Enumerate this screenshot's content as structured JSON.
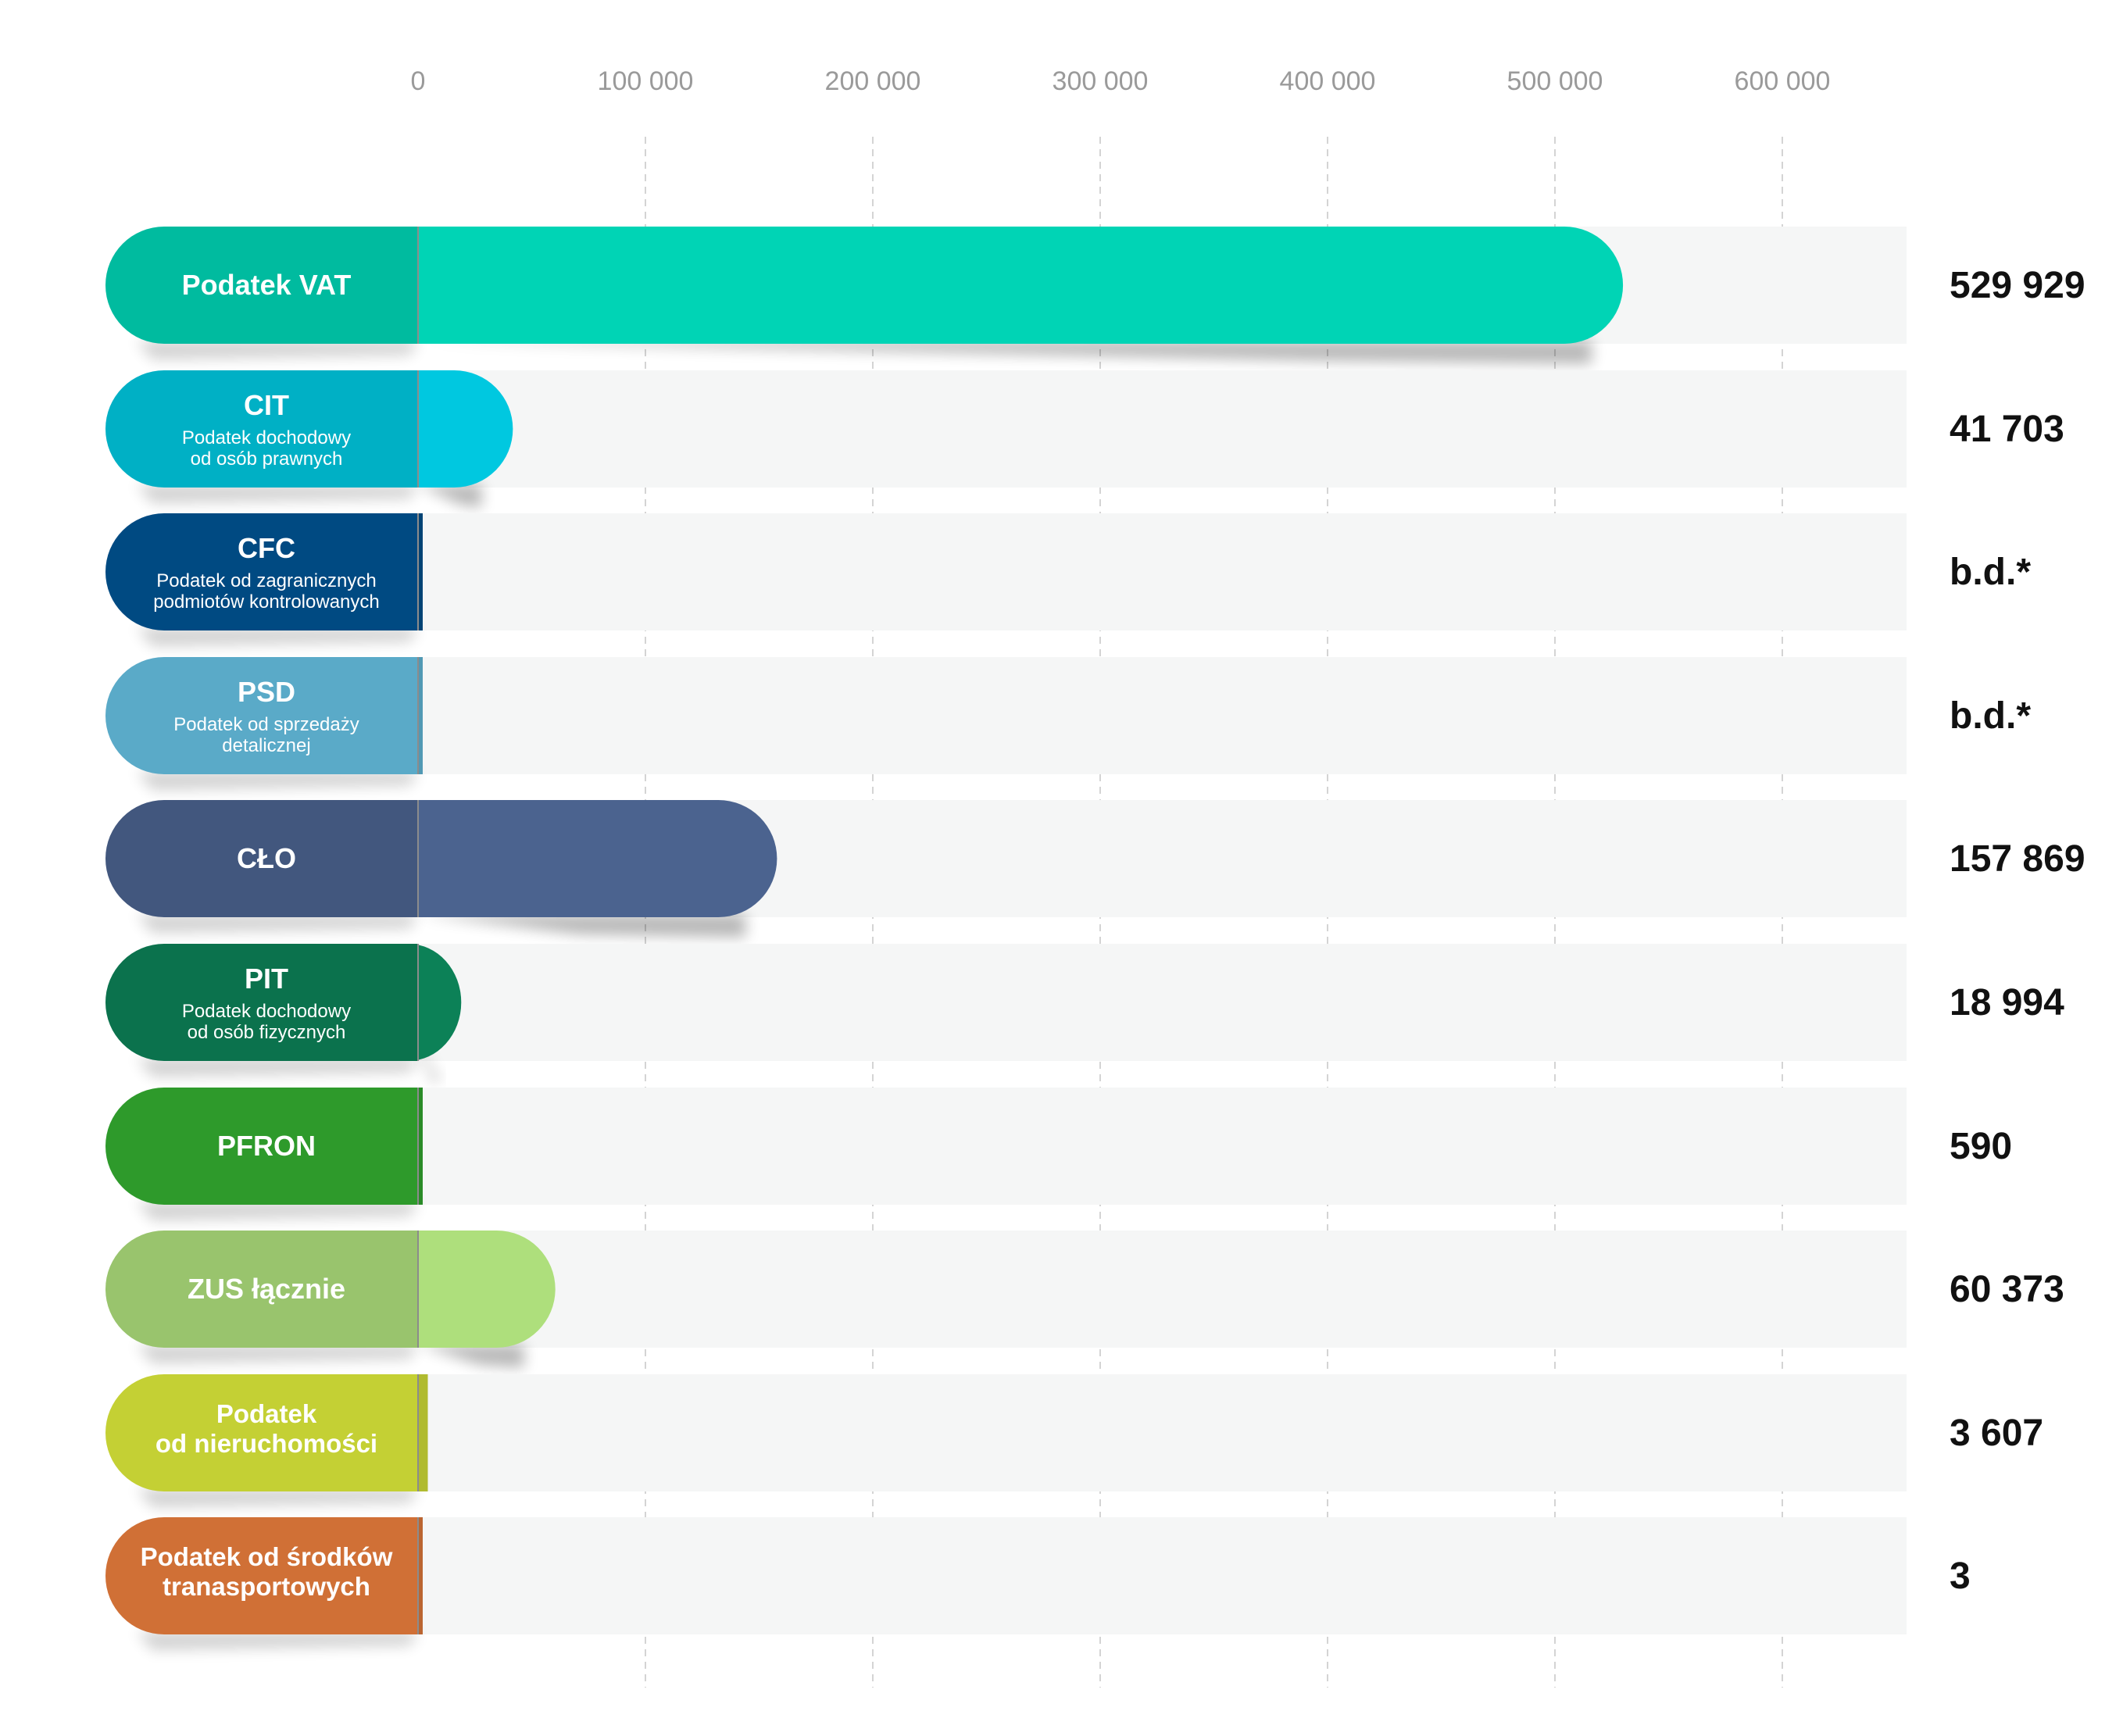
{
  "chart_data": {
    "type": "bar",
    "orientation": "horizontal",
    "x_ticks": [
      "0",
      "100 000",
      "200 000",
      "300 000",
      "400 000",
      "500 000",
      "600 000"
    ],
    "xlim": [
      0,
      650000
    ],
    "grid": "vertical dashed",
    "categories": [
      {
        "title": "Podatek VAT",
        "subtitle": [],
        "value": 529929,
        "value_label": "529 929",
        "color": "#00d4b5"
      },
      {
        "title": "CIT",
        "subtitle": [
          "Podatek dochodowy",
          "od osób prawnych"
        ],
        "value": 41703,
        "value_label": "41 703",
        "color": "#00c8e0"
      },
      {
        "title": "CFC",
        "subtitle": [
          "Podatek od zagranicznych",
          "podmiotów kontrolowanych"
        ],
        "value": 0,
        "value_label": "b.d.*",
        "color": "#004a82"
      },
      {
        "title": "PSD",
        "subtitle": [
          "Podatek od sprzedaży",
          "detalicznej"
        ],
        "value": 0,
        "value_label": "b.d.*",
        "color": "#5aaac8"
      },
      {
        "title": "CŁO",
        "subtitle": [],
        "value": 157869,
        "value_label": "157 869",
        "color": "#4b638f"
      },
      {
        "title": "PIT",
        "subtitle": [
          "Podatek dochodowy",
          "od osób fizycznych"
        ],
        "value": 18994,
        "value_label": "18 994",
        "color": "#0c8157"
      },
      {
        "title": "PFRON",
        "subtitle": [],
        "value": 590,
        "value_label": "590",
        "color": "#2e9a2b"
      },
      {
        "title": "ZUS łącznie",
        "subtitle": [],
        "value": 60373,
        "value_label": "60 373",
        "color": "#aedf7c"
      },
      {
        "title": "Podatek\nod nieruchomości",
        "subtitle": [],
        "value": 3607,
        "value_label": "3 607",
        "color": "#c4d034"
      },
      {
        "title": "Podatek od środków\ntranasportowych",
        "subtitle": [],
        "value": 3,
        "value_label": "3",
        "color": "#d07036"
      }
    ],
    "colors": {
      "track": "#f5f6f6",
      "grid": "#d4d4d4",
      "tick_text": "#9a9a9a",
      "value_text": "#111111",
      "zero_line": "#8c8c8c"
    }
  }
}
